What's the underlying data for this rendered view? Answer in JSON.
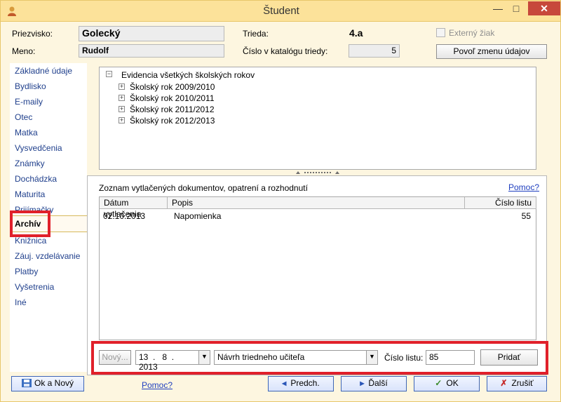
{
  "window": {
    "title": "Študent",
    "minimize_glyph": "—",
    "maximize_glyph": "□",
    "close_glyph": "✕"
  },
  "header": {
    "surname_label": "Priezvisko:",
    "surname_value": "Golecký",
    "name_label": "Meno:",
    "name_value": "Rudolf",
    "class_label": "Trieda:",
    "class_value": "4.a",
    "catalog_label": "Číslo v katalógu triedy:",
    "catalog_value": "5",
    "external_label": "Externý žiak",
    "allow_edit_button": "Povoľ zmenu údajov"
  },
  "sidebar": {
    "items": [
      {
        "label": "Základné údaje"
      },
      {
        "label": "Bydlisko"
      },
      {
        "label": "E-maily"
      },
      {
        "label": "Otec"
      },
      {
        "label": "Matka"
      },
      {
        "label": "Vysvedčenia"
      },
      {
        "label": "Známky"
      },
      {
        "label": "Dochádzka"
      },
      {
        "label": "Maturita"
      },
      {
        "label": "Prijímačky"
      },
      {
        "label": "Archív"
      },
      {
        "label": "Knižnica"
      },
      {
        "label": "Záuj. vzdelávanie"
      },
      {
        "label": "Platby"
      },
      {
        "label": "Vyšetrenia"
      },
      {
        "label": "Iné"
      }
    ]
  },
  "tree": {
    "root": "Evidencia všetkých školských rokov",
    "years": [
      "Školský rok 2009/2010",
      "Školský rok 2010/2011",
      "Školský rok 2011/2012",
      "Školský rok 2012/2013"
    ]
  },
  "documents": {
    "title": "Zoznam vytlačených dokumentov, opatrení a rozhodnutí",
    "help_link": "Pomoc?",
    "columns": [
      "Dátum vytlačenia",
      "Popis",
      "Číslo listu"
    ],
    "rows": [
      {
        "date": "02.10.2013",
        "description": "Napomienka",
        "sheet": "55"
      }
    ]
  },
  "addbar": {
    "new_button": "Nový...",
    "date_day": "13",
    "date_month": "8",
    "date_year": "2013",
    "template_value": "Návrh triedneho učiteľa",
    "sheet_label": "Číslo listu:",
    "sheet_value": "85",
    "add_button": "Pridať"
  },
  "footer": {
    "ok_new_button": "Ok a Nový",
    "help_link": "Pomoc?",
    "prev_button": "Predch.",
    "next_button": "Ďalší",
    "ok_button": "OK",
    "cancel_button": "Zrušiť"
  },
  "colors": {
    "titlebar": "#fce29a",
    "window": "#fdf6e0",
    "highlight": "#e0202a",
    "link": "#1f3fbf"
  }
}
